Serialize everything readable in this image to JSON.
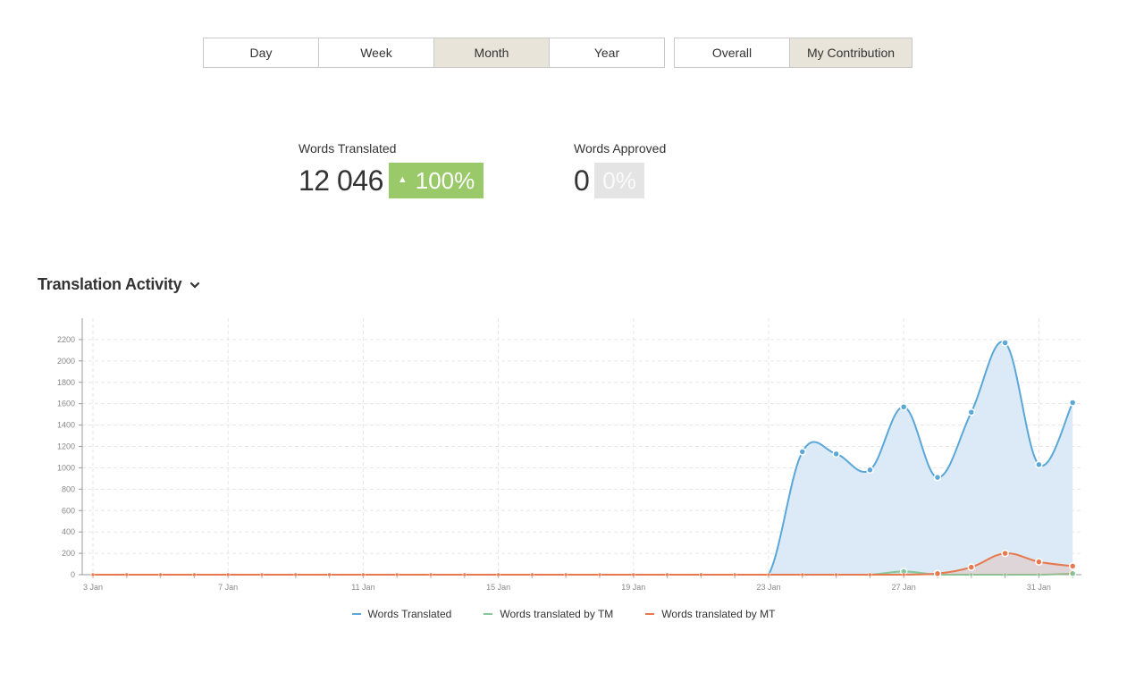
{
  "period_buttons": [
    {
      "label": "Day",
      "active": false
    },
    {
      "label": "Week",
      "active": false
    },
    {
      "label": "Month",
      "active": true
    },
    {
      "label": "Year",
      "active": false
    }
  ],
  "scope_buttons": [
    {
      "label": "Overall",
      "active": false
    },
    {
      "label": "My Contribution",
      "active": true
    }
  ],
  "stats": {
    "translated": {
      "label": "Words Translated",
      "value": "12 046",
      "change": "100%",
      "direction": "up"
    },
    "approved": {
      "label": "Words Approved",
      "value": "0",
      "change": "0%"
    }
  },
  "section": {
    "title": "Translation Activity",
    "icon": "chevron-down-icon"
  },
  "chart_data": {
    "type": "area",
    "x_labels": [
      "3 Jan",
      "7 Jan",
      "11 Jan",
      "15 Jan",
      "19 Jan",
      "23 Jan",
      "27 Jan",
      "31 Jan"
    ],
    "x": [
      "3 Jan",
      "4 Jan",
      "5 Jan",
      "6 Jan",
      "7 Jan",
      "8 Jan",
      "9 Jan",
      "10 Jan",
      "11 Jan",
      "12 Jan",
      "13 Jan",
      "14 Jan",
      "15 Jan",
      "16 Jan",
      "17 Jan",
      "18 Jan",
      "19 Jan",
      "20 Jan",
      "21 Jan",
      "22 Jan",
      "23 Jan",
      "24 Jan",
      "25 Jan",
      "26 Jan",
      "27 Jan",
      "28 Jan",
      "29 Jan",
      "30 Jan",
      "31 Jan",
      "1 Feb"
    ],
    "ylim": [
      0,
      2400
    ],
    "yticks": [
      0,
      200,
      400,
      600,
      800,
      1000,
      1200,
      1400,
      1600,
      1800,
      2000,
      2200
    ],
    "grid": true,
    "legend_position": "bottom",
    "series": [
      {
        "name": "Words Translated",
        "color": "#5aa7d8",
        "values": [
          0,
          0,
          0,
          0,
          0,
          0,
          0,
          0,
          0,
          0,
          0,
          0,
          0,
          0,
          0,
          0,
          0,
          0,
          0,
          0,
          0,
          1150,
          1130,
          980,
          1570,
          910,
          1520,
          2170,
          1030,
          1610
        ]
      },
      {
        "name": "Words translated by TM",
        "color": "#86c79a",
        "values": [
          0,
          0,
          0,
          0,
          0,
          0,
          0,
          0,
          0,
          0,
          0,
          0,
          0,
          0,
          0,
          0,
          0,
          0,
          0,
          0,
          0,
          0,
          0,
          0,
          30,
          0,
          0,
          0,
          0,
          10
        ]
      },
      {
        "name": "Words translated by MT",
        "color": "#e8784e",
        "values": [
          0,
          0,
          0,
          0,
          0,
          0,
          0,
          0,
          0,
          0,
          0,
          0,
          0,
          0,
          0,
          0,
          0,
          0,
          0,
          0,
          0,
          0,
          0,
          0,
          0,
          10,
          70,
          200,
          120,
          80
        ]
      }
    ]
  }
}
